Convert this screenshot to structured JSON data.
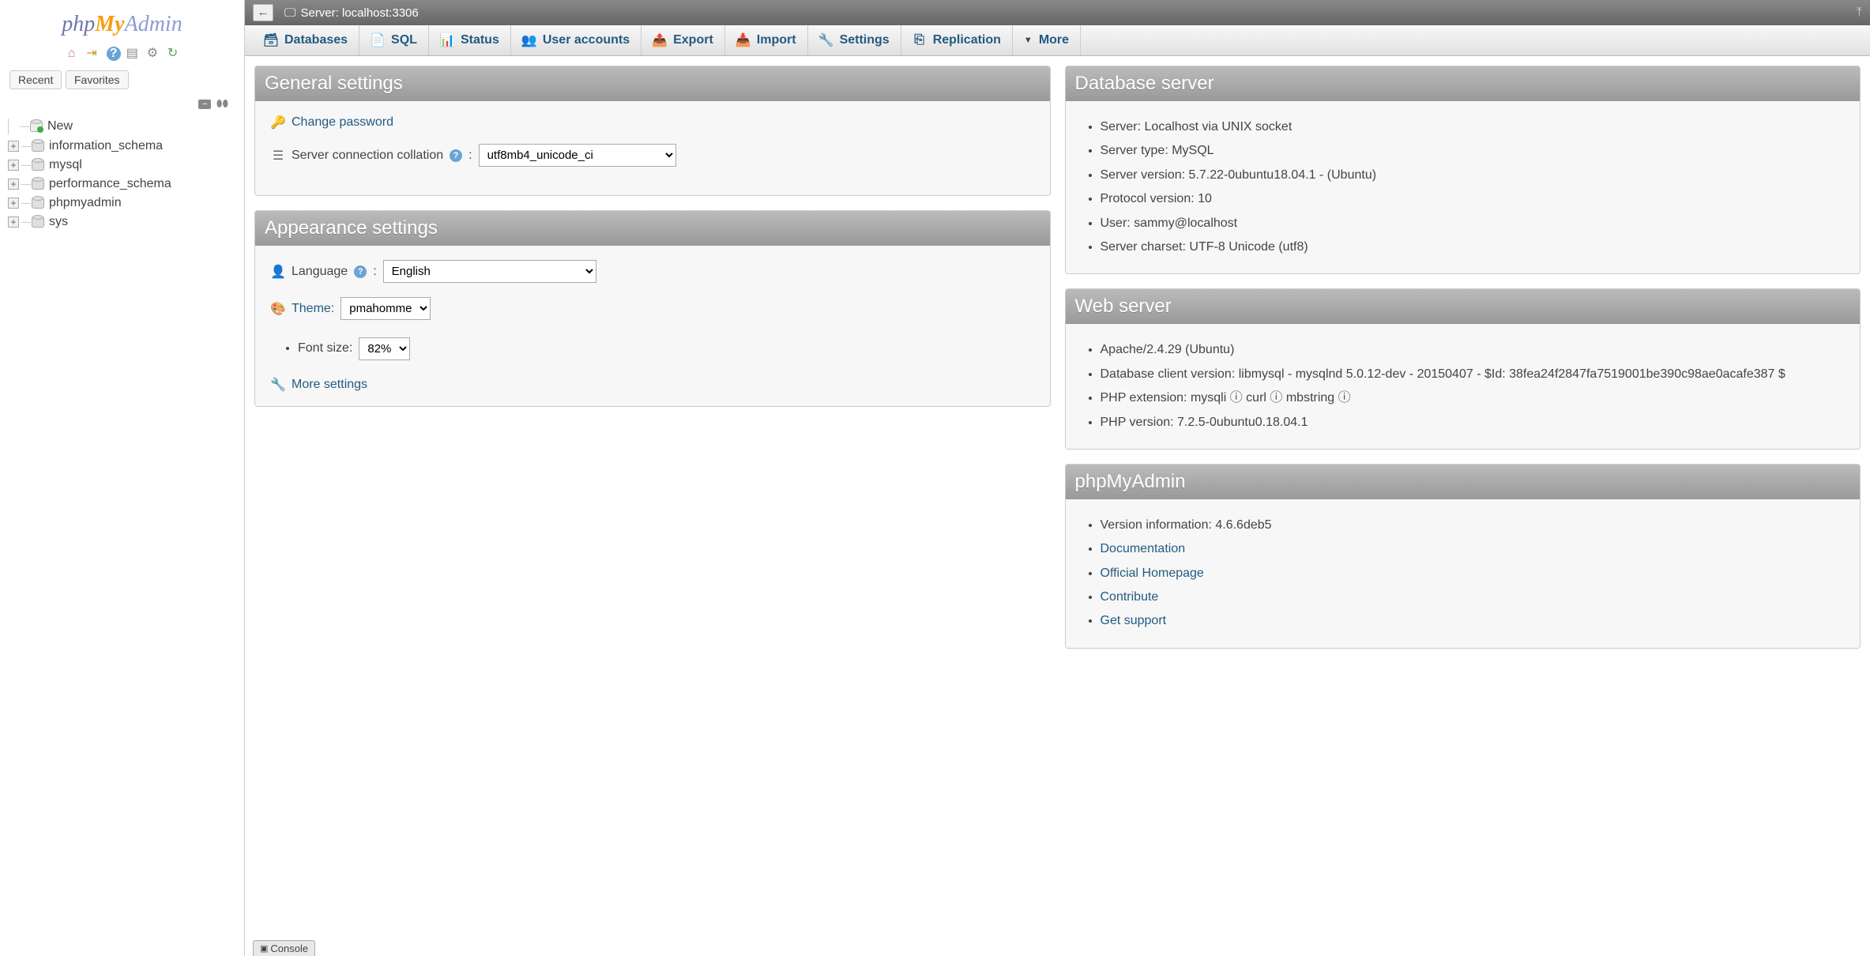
{
  "logo": {
    "php": "php",
    "my": "My",
    "admin": "Admin"
  },
  "sidebar": {
    "recent": "Recent",
    "favorites": "Favorites",
    "new_label": "New",
    "databases": [
      "information_schema",
      "mysql",
      "performance_schema",
      "phpmyadmin",
      "sys"
    ]
  },
  "topbar": {
    "back": "←",
    "server_label": "Server: localhost:3306"
  },
  "tabs": {
    "databases": "Databases",
    "sql": "SQL",
    "status": "Status",
    "user_accounts": "User accounts",
    "export": "Export",
    "import": "Import",
    "settings": "Settings",
    "replication": "Replication",
    "more": "More"
  },
  "panels": {
    "general": {
      "title": "General settings",
      "change_password": "Change password",
      "collation_label": "Server connection collation",
      "collation_value": "utf8mb4_unicode_ci"
    },
    "appearance": {
      "title": "Appearance settings",
      "language_label": "Language",
      "language_value": "English",
      "theme_label": "Theme:",
      "theme_value": "pmahomme",
      "font_label": "Font size:",
      "font_value": "82%",
      "more_settings": "More settings"
    },
    "db_server": {
      "title": "Database server",
      "items": [
        "Server: Localhost via UNIX socket",
        "Server type: MySQL",
        "Server version: 5.7.22-0ubuntu18.04.1 - (Ubuntu)",
        "Protocol version: 10",
        "User: sammy@localhost",
        "Server charset: UTF-8 Unicode (utf8)"
      ]
    },
    "web_server": {
      "title": "Web server",
      "items": [
        "Apache/2.4.29 (Ubuntu)",
        "Database client version: libmysql - mysqlnd 5.0.12-dev - 20150407 - $Id: 38fea24f2847fa7519001be390c98ae0acafe387 $",
        "PHP extension: mysqli ⓘ curl ⓘ mbstring ⓘ",
        "PHP version: 7.2.5-0ubuntu0.18.04.1"
      ]
    },
    "pma": {
      "title": "phpMyAdmin",
      "version_label": "Version information: 4.6.6deb5",
      "links": [
        "Documentation",
        "Official Homepage",
        "Contribute",
        "Get support"
      ]
    }
  },
  "console": "Console"
}
